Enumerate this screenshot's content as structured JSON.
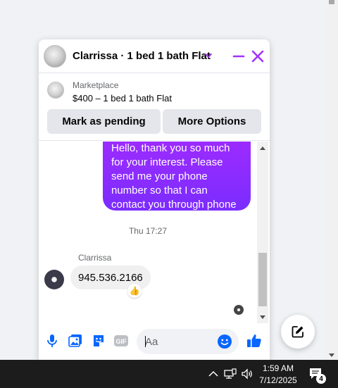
{
  "chat": {
    "title": "Clarrissa · 1 bed 1 bath Flat",
    "marketplace_label": "Marketplace",
    "listing": "$400 – 1 bed 1 bath Flat",
    "mark_pending_label": "Mark as pending",
    "more_options_label": "More Options",
    "outgoing_message_lines": [
      "Hello, thank you so much",
      "for your interest. Please",
      "send me your phone",
      "number so that I can",
      "contact you through phone"
    ],
    "timestamp": "Thu 17:27",
    "sender_name": "Clarrissa",
    "incoming_message": "945.536.2166",
    "reaction": "👍",
    "composer_placeholder": "Aa"
  },
  "icons": {
    "header_chevron": "chevron-down-icon",
    "minimize": "minimize-icon",
    "close": "close-icon",
    "mic": "microphone-icon",
    "photo": "photo-icon",
    "sticker": "sticker-icon",
    "gif": "gif-icon",
    "emoji": "emoji-icon",
    "like": "thumbs-up-icon",
    "new_message": "new-message-icon"
  },
  "colors": {
    "accent": "#a033ff",
    "brand_blue": "#0866ff",
    "bubble_out_top": "#a12bff",
    "bubble_out_bottom": "#7b2cff"
  },
  "taskbar": {
    "time": "1:59 AM",
    "date": "7/12/2025",
    "notification_count": "4"
  }
}
